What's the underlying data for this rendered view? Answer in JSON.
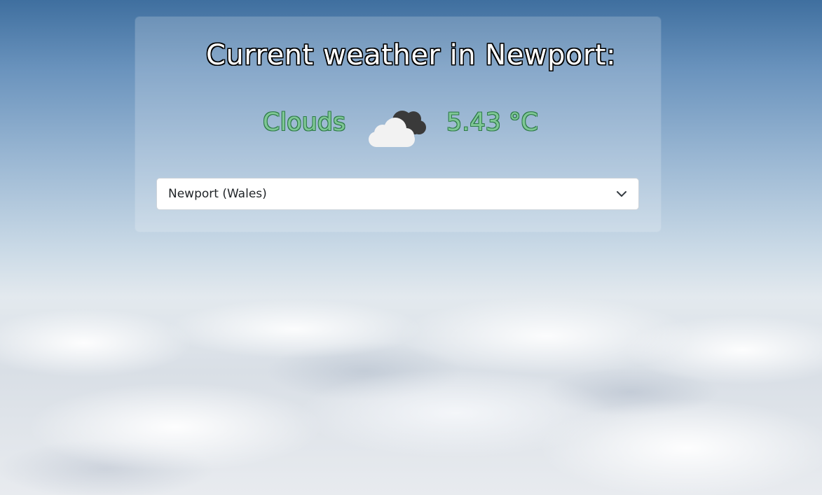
{
  "page": {
    "title": "Current weather in Newport:"
  },
  "weather": {
    "condition": "Clouds",
    "temperature": "5.43 °C",
    "icon": "cloud-icon"
  },
  "city_select": {
    "selected": "Newport (Wales)",
    "options": [
      "Newport (Wales)"
    ]
  },
  "colors": {
    "condition_text": "#7ec794",
    "condition_outline": "#2d7a47",
    "card_background": "rgba(255,255,255,0.2)",
    "sky_top": "#3f6f9f"
  }
}
